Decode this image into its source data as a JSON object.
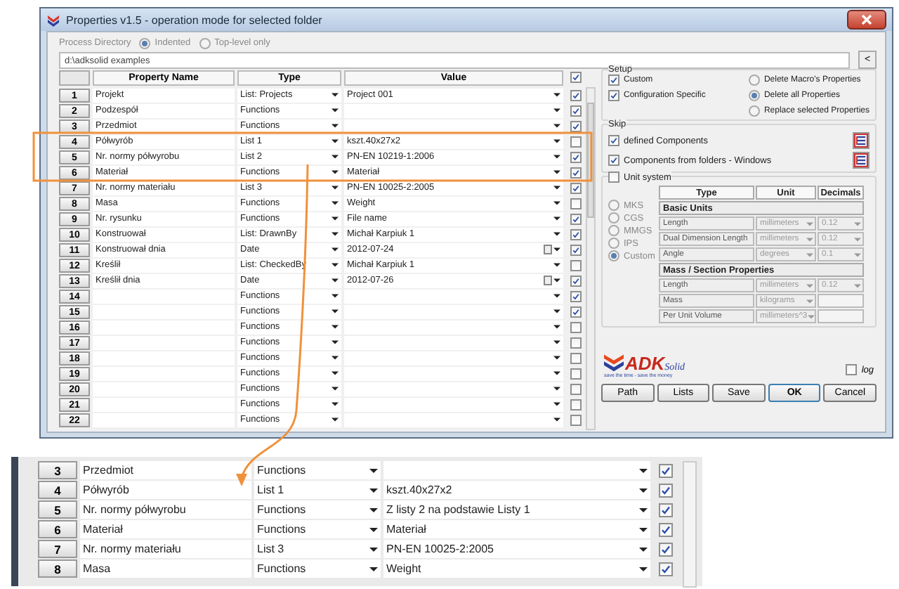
{
  "window": {
    "title": "Properties v1.5 - operation mode for selected folder"
  },
  "process_directory": {
    "label": "Process Directory",
    "options": [
      {
        "label": "Indented",
        "selected": true
      },
      {
        "label": "Top-level only",
        "selected": false
      }
    ]
  },
  "path_field": {
    "value": "d:\\adksolid examples",
    "button": "<"
  },
  "table": {
    "columns": [
      "Property Name",
      "Type",
      "Value"
    ],
    "all_checked": true,
    "rows": [
      {
        "number": "1",
        "name": "Projekt",
        "type": "List: Projects",
        "value": "Project 001",
        "kind": "list",
        "checked": true
      },
      {
        "number": "2",
        "name": "Podzespół",
        "type": "Functions",
        "kind": "list",
        "checked": true
      },
      {
        "number": "3",
        "name": "Przedmiot",
        "type": "Functions",
        "kind": "list",
        "checked": true
      },
      {
        "number": "4",
        "name": "Półwyrób",
        "type": "List 1",
        "value": "kszt.40x27x2",
        "kind": "list",
        "checked": false
      },
      {
        "number": "5",
        "name": "Nr. normy półwyrobu",
        "type": "List 2",
        "value": "PN-EN 10219-1:2006",
        "kind": "list",
        "checked": true
      },
      {
        "number": "6",
        "name": "Materiał",
        "type": "Functions",
        "value": "Materiał",
        "kind": "list",
        "checked": true
      },
      {
        "number": "7",
        "name": "Nr. normy materiału",
        "type": "List 3",
        "value": "PN-EN 10025-2:2005",
        "kind": "list",
        "checked": true
      },
      {
        "number": "8",
        "name": "Masa",
        "type": "Functions",
        "value": "Weight",
        "kind": "list",
        "checked": false
      },
      {
        "number": "9",
        "name": "Nr. rysunku",
        "type": "Functions",
        "value": "File name",
        "kind": "list",
        "checked": true
      },
      {
        "number": "10",
        "name": "Konstruował",
        "type": "List: DrawnBy",
        "value": "Michał Karpiuk 1",
        "kind": "list",
        "checked": true
      },
      {
        "number": "11",
        "name": "Konstruował dnia",
        "type": "Date",
        "value": "2012-07-24",
        "kind": "date",
        "checked": true
      },
      {
        "number": "12",
        "name": "Kreślił",
        "type": "List: CheckedBy",
        "value": "Michał Karpiuk 1",
        "kind": "list",
        "checked": false
      },
      {
        "number": "13",
        "name": "Kreślił dnia",
        "type": "Date",
        "value": "2012-07-26",
        "kind": "date",
        "checked": true
      },
      {
        "number": "14",
        "type": "Functions",
        "kind": "list",
        "checked": true
      },
      {
        "number": "15",
        "type": "Functions",
        "kind": "list",
        "checked": true
      },
      {
        "number": "16",
        "type": "Functions",
        "kind": "list",
        "checked": false
      },
      {
        "number": "17",
        "type": "Functions",
        "kind": "list",
        "checked": false
      },
      {
        "number": "18",
        "type": "Functions",
        "kind": "list",
        "checked": false
      },
      {
        "number": "19",
        "type": "Functions",
        "kind": "list",
        "checked": false
      },
      {
        "number": "20",
        "type": "Functions",
        "kind": "list",
        "checked": false
      },
      {
        "number": "21",
        "type": "Functions",
        "kind": "list",
        "checked": false
      },
      {
        "number": "22",
        "type": "Functions",
        "kind": "list",
        "checked": false
      }
    ]
  },
  "setup": {
    "title": "Setup",
    "options": [
      {
        "label": "Custom",
        "checked": true
      },
      {
        "label": "Configuration Specific",
        "checked": true
      }
    ],
    "delete_modes": [
      {
        "label": "Delete Macro's Properties",
        "selected": false
      },
      {
        "label": "Delete all Properties",
        "selected": true
      },
      {
        "label": "Replace selected Properties",
        "selected": false
      }
    ]
  },
  "skip": {
    "title": "Skip",
    "options": [
      {
        "label": "defined Components",
        "checked": true
      },
      {
        "label": "Components from folders - Windows",
        "checked": true
      }
    ]
  },
  "unit_system": {
    "label": "Unit system",
    "checked": false,
    "systems": [
      {
        "label": "MKS",
        "selected": false
      },
      {
        "label": "CGS",
        "selected": false
      },
      {
        "label": "MMGS",
        "selected": false
      },
      {
        "label": "IPS",
        "selected": false
      },
      {
        "label": "Custom",
        "selected": true
      }
    ],
    "columns": [
      "Type",
      "Unit",
      "Decimals"
    ],
    "sections": [
      {
        "title": "Basic Units",
        "rows": [
          {
            "type": "Length",
            "unit": "millimeters",
            "decimals": "0.12"
          },
          {
            "type": "Dual Dimension Length",
            "unit": "millimeters",
            "decimals": "0.12"
          },
          {
            "type": "Angle",
            "unit": "degrees",
            "decimals": "0.1"
          }
        ]
      },
      {
        "title": "Mass / Section Properties",
        "rows": [
          {
            "type": "Length",
            "unit": "millimeters",
            "decimals": "0.12"
          },
          {
            "type": "Mass",
            "unit": "kilograms"
          },
          {
            "type": "Per Unit Volume",
            "unit": "millimeters^3"
          }
        ]
      }
    ]
  },
  "logo": {
    "name": "ADK",
    "sub": "Solid",
    "tagline": "save the time - save the money"
  },
  "log": {
    "label": "log",
    "checked": false
  },
  "buttons": [
    {
      "label": "Path",
      "default": false
    },
    {
      "label": "Lists",
      "default": false
    },
    {
      "label": "Save",
      "default": false
    },
    {
      "label": "OK",
      "default": true
    },
    {
      "label": "Cancel",
      "default": false
    }
  ],
  "zoom_inset": {
    "rows": [
      {
        "number": "3",
        "name": "Przedmiot",
        "type": "Functions",
        "checked": true
      },
      {
        "number": "4",
        "name": "Półwyrób",
        "type": "List 1",
        "value": "kszt.40x27x2",
        "checked": true
      },
      {
        "number": "5",
        "name": "Nr. normy półwyrobu",
        "type": "Functions",
        "value": "Z listy 2 na podstawie Listy 1",
        "checked": true
      },
      {
        "number": "6",
        "name": "Materiał",
        "type": "Functions",
        "value": "Materiał",
        "checked": true
      },
      {
        "number": "7",
        "name": "Nr. normy materiału",
        "type": "List 3",
        "value": "PN-EN 10025-2:2005",
        "checked": true
      },
      {
        "number": "8",
        "name": "Masa",
        "type": "Functions",
        "value": "Weight",
        "checked": true
      }
    ]
  }
}
